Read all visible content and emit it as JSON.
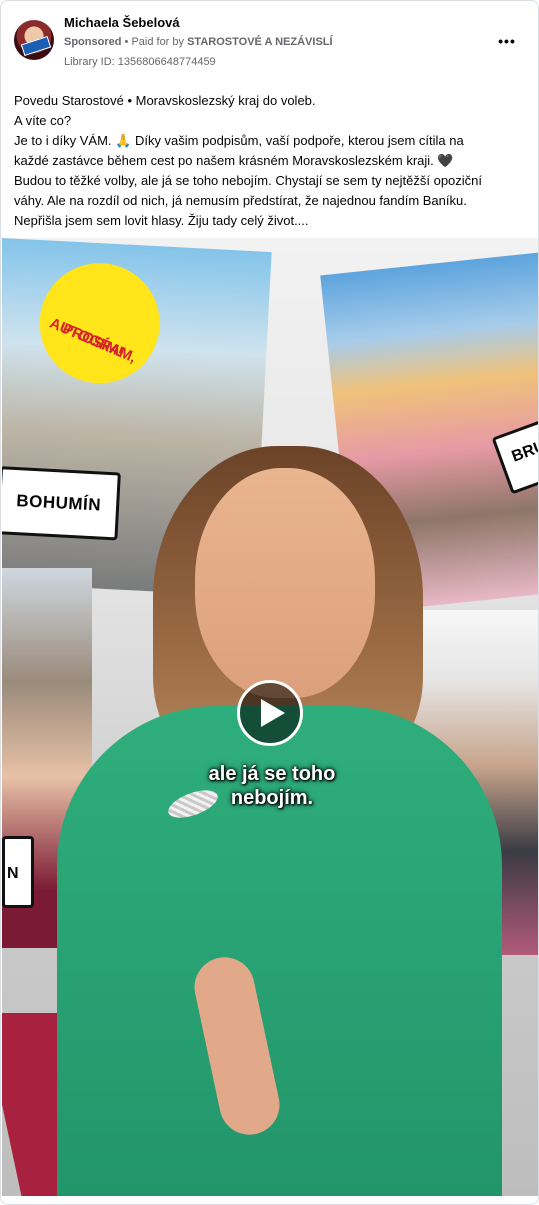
{
  "post": {
    "author": "Michaela Šebelová",
    "sponsored": "Sponsored",
    "separator": "•",
    "paid_for_prefix": "Paid for by",
    "paid_for_by": "STAROSTOVÉ A NEZÁVISLÍ",
    "library_id": "Library ID: 1356806648774459",
    "more_icon": "more-horizontal-icon",
    "text_lines": [
      "Povedu Starostové • Moravskoslezský kraj do voleb.",
      "A víte co?",
      "Je to i díky VÁM. 🙏 Díky vašim podpisům, vaší podpoře, kterou jsem cítila na",
      "každé zastávce během cest po našem krásném Moravskoslezském kraji. 🖤",
      "Budou to těžké volby, ale já se toho nebojím. Chystají se sem ty nejtěžší opoziční",
      "váhy. Ale na rozdíl od nich, já nemusím předstírat, že najednou fandím Baníku.",
      "Nepřišla jsem sem lovit hlasy. Žiju tady celý život...."
    ]
  },
  "video": {
    "play_icon": "play-icon",
    "caption_line1": "ale já se toho",
    "caption_line2": "nebojím.",
    "sticker_line1": "AUTOGRAM,",
    "sticker_line2": "PROSÍM!",
    "sign_left": "BOHUMÍN",
    "sign_right": "BRU",
    "sign_bottom_left": "N"
  }
}
